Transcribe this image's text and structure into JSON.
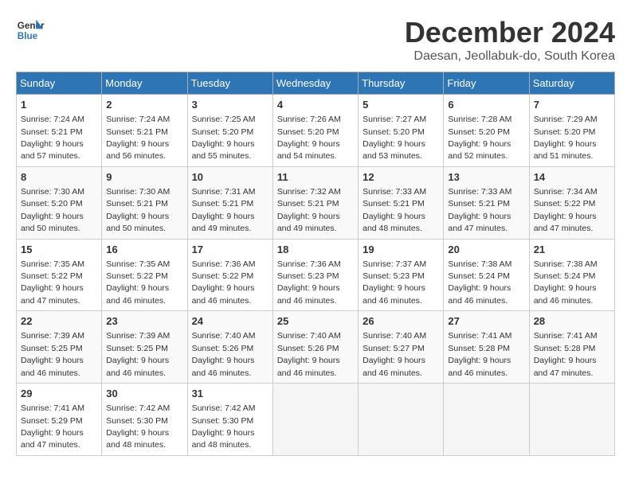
{
  "header": {
    "logo_line1": "General",
    "logo_line2": "Blue",
    "month_title": "December 2024",
    "location": "Daesan, Jeollabuk-do, South Korea"
  },
  "weekdays": [
    "Sunday",
    "Monday",
    "Tuesday",
    "Wednesday",
    "Thursday",
    "Friday",
    "Saturday"
  ],
  "weeks": [
    [
      {
        "day": "1",
        "detail": "Sunrise: 7:24 AM\nSunset: 5:21 PM\nDaylight: 9 hours\nand 57 minutes."
      },
      {
        "day": "2",
        "detail": "Sunrise: 7:24 AM\nSunset: 5:21 PM\nDaylight: 9 hours\nand 56 minutes."
      },
      {
        "day": "3",
        "detail": "Sunrise: 7:25 AM\nSunset: 5:20 PM\nDaylight: 9 hours\nand 55 minutes."
      },
      {
        "day": "4",
        "detail": "Sunrise: 7:26 AM\nSunset: 5:20 PM\nDaylight: 9 hours\nand 54 minutes."
      },
      {
        "day": "5",
        "detail": "Sunrise: 7:27 AM\nSunset: 5:20 PM\nDaylight: 9 hours\nand 53 minutes."
      },
      {
        "day": "6",
        "detail": "Sunrise: 7:28 AM\nSunset: 5:20 PM\nDaylight: 9 hours\nand 52 minutes."
      },
      {
        "day": "7",
        "detail": "Sunrise: 7:29 AM\nSunset: 5:20 PM\nDaylight: 9 hours\nand 51 minutes."
      }
    ],
    [
      {
        "day": "8",
        "detail": "Sunrise: 7:30 AM\nSunset: 5:20 PM\nDaylight: 9 hours\nand 50 minutes."
      },
      {
        "day": "9",
        "detail": "Sunrise: 7:30 AM\nSunset: 5:21 PM\nDaylight: 9 hours\nand 50 minutes."
      },
      {
        "day": "10",
        "detail": "Sunrise: 7:31 AM\nSunset: 5:21 PM\nDaylight: 9 hours\nand 49 minutes."
      },
      {
        "day": "11",
        "detail": "Sunrise: 7:32 AM\nSunset: 5:21 PM\nDaylight: 9 hours\nand 49 minutes."
      },
      {
        "day": "12",
        "detail": "Sunrise: 7:33 AM\nSunset: 5:21 PM\nDaylight: 9 hours\nand 48 minutes."
      },
      {
        "day": "13",
        "detail": "Sunrise: 7:33 AM\nSunset: 5:21 PM\nDaylight: 9 hours\nand 47 minutes."
      },
      {
        "day": "14",
        "detail": "Sunrise: 7:34 AM\nSunset: 5:22 PM\nDaylight: 9 hours\nand 47 minutes."
      }
    ],
    [
      {
        "day": "15",
        "detail": "Sunrise: 7:35 AM\nSunset: 5:22 PM\nDaylight: 9 hours\nand 47 minutes."
      },
      {
        "day": "16",
        "detail": "Sunrise: 7:35 AM\nSunset: 5:22 PM\nDaylight: 9 hours\nand 46 minutes."
      },
      {
        "day": "17",
        "detail": "Sunrise: 7:36 AM\nSunset: 5:22 PM\nDaylight: 9 hours\nand 46 minutes."
      },
      {
        "day": "18",
        "detail": "Sunrise: 7:36 AM\nSunset: 5:23 PM\nDaylight: 9 hours\nand 46 minutes."
      },
      {
        "day": "19",
        "detail": "Sunrise: 7:37 AM\nSunset: 5:23 PM\nDaylight: 9 hours\nand 46 minutes."
      },
      {
        "day": "20",
        "detail": "Sunrise: 7:38 AM\nSunset: 5:24 PM\nDaylight: 9 hours\nand 46 minutes."
      },
      {
        "day": "21",
        "detail": "Sunrise: 7:38 AM\nSunset: 5:24 PM\nDaylight: 9 hours\nand 46 minutes."
      }
    ],
    [
      {
        "day": "22",
        "detail": "Sunrise: 7:39 AM\nSunset: 5:25 PM\nDaylight: 9 hours\nand 46 minutes."
      },
      {
        "day": "23",
        "detail": "Sunrise: 7:39 AM\nSunset: 5:25 PM\nDaylight: 9 hours\nand 46 minutes."
      },
      {
        "day": "24",
        "detail": "Sunrise: 7:40 AM\nSunset: 5:26 PM\nDaylight: 9 hours\nand 46 minutes."
      },
      {
        "day": "25",
        "detail": "Sunrise: 7:40 AM\nSunset: 5:26 PM\nDaylight: 9 hours\nand 46 minutes."
      },
      {
        "day": "26",
        "detail": "Sunrise: 7:40 AM\nSunset: 5:27 PM\nDaylight: 9 hours\nand 46 minutes."
      },
      {
        "day": "27",
        "detail": "Sunrise: 7:41 AM\nSunset: 5:28 PM\nDaylight: 9 hours\nand 46 minutes."
      },
      {
        "day": "28",
        "detail": "Sunrise: 7:41 AM\nSunset: 5:28 PM\nDaylight: 9 hours\nand 47 minutes."
      }
    ],
    [
      {
        "day": "29",
        "detail": "Sunrise: 7:41 AM\nSunset: 5:29 PM\nDaylight: 9 hours\nand 47 minutes."
      },
      {
        "day": "30",
        "detail": "Sunrise: 7:42 AM\nSunset: 5:30 PM\nDaylight: 9 hours\nand 48 minutes."
      },
      {
        "day": "31",
        "detail": "Sunrise: 7:42 AM\nSunset: 5:30 PM\nDaylight: 9 hours\nand 48 minutes."
      },
      null,
      null,
      null,
      null
    ]
  ]
}
